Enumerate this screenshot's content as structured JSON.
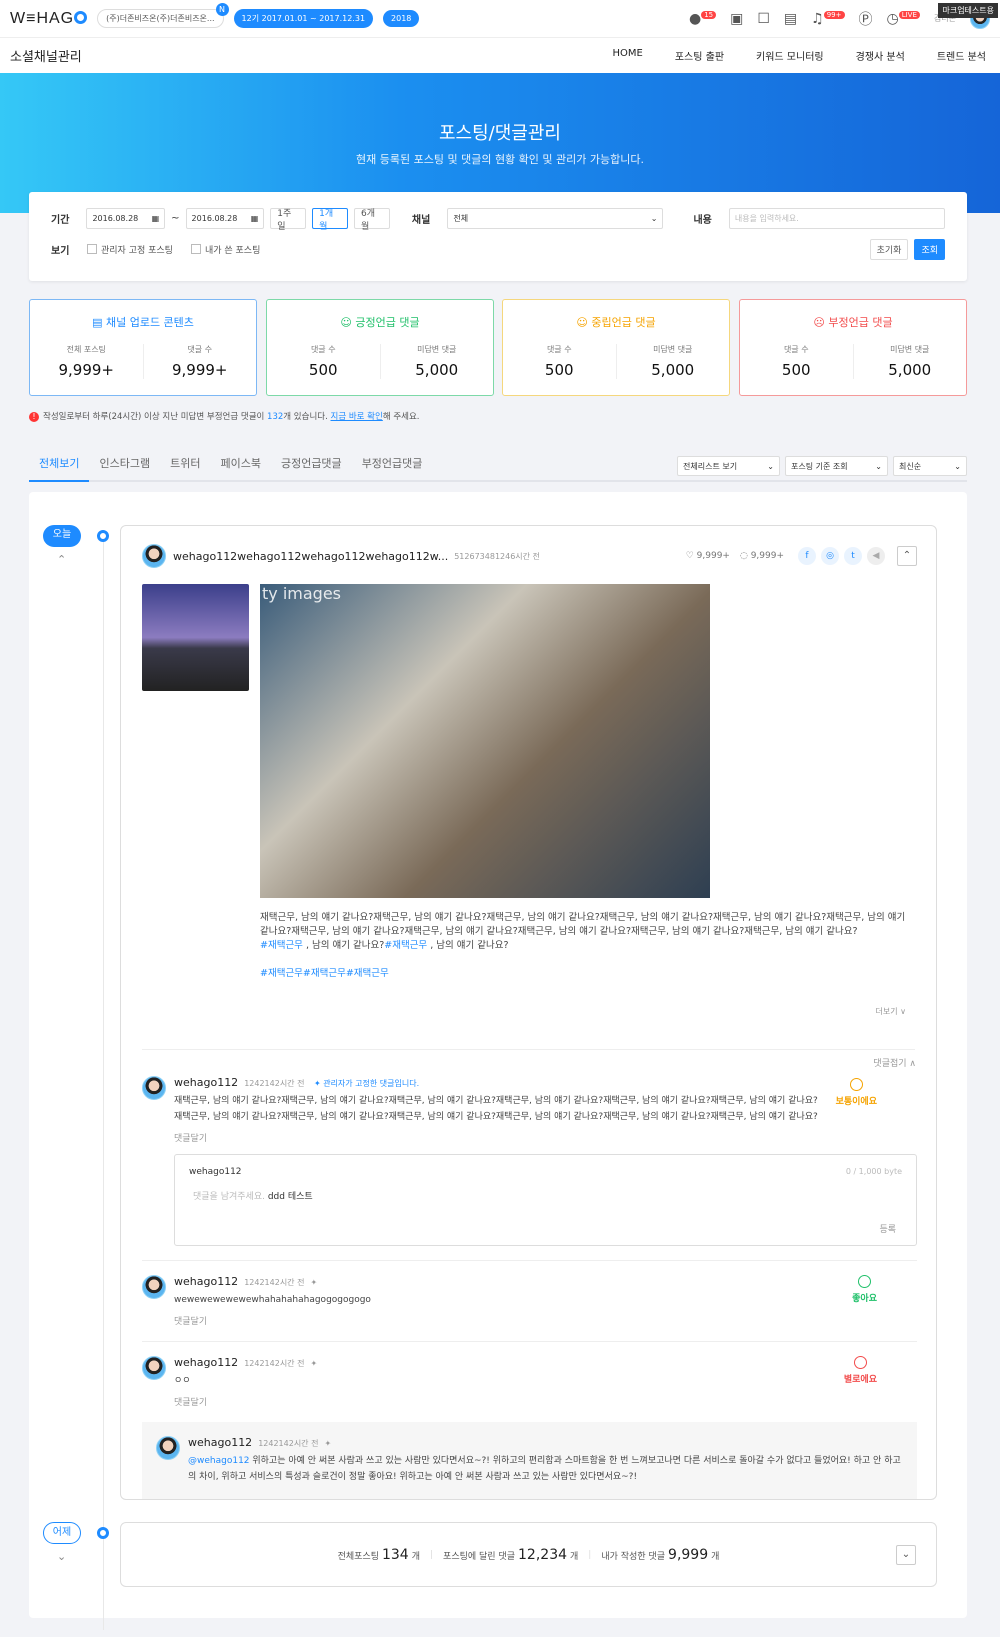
{
  "topbar": {
    "logo": "WEHAGO",
    "company": "(주)더존비즈온(주)더존비즈온...",
    "new_badge": "N",
    "period": "12기 2017.01.01 ~ 2017.12.31",
    "year": "2018",
    "profile_badge": "15",
    "bell_badge": "99+",
    "live_badge": "LIVE",
    "user_name": "김더존",
    "tag": "마크업테스트용"
  },
  "nav": {
    "title": "소셜채널관리",
    "menu": [
      "HOME",
      "포스팅 출판",
      "키워드 모니터링",
      "경쟁사 분석",
      "트렌드 분석"
    ]
  },
  "banner": {
    "title": "포스팅/댓글관리",
    "subtitle": "현재 등록된 포스팅 및 댓글의 현황 확인 및 관리가 가능합니다."
  },
  "filter": {
    "period_label": "기간",
    "date_from": "2016.08.28",
    "date_to": "2016.08.28",
    "range_buttons": [
      "1주일",
      "1개월",
      "6개월"
    ],
    "channel_label": "채널",
    "channel_value": "전체",
    "content_label": "내용",
    "content_placeholder": "내용을 입력하세요.",
    "view_label": "보기",
    "check1": "관리자 고정 포스팅",
    "check2": "내가 쓴 포스팅",
    "reset": "초기화",
    "search": "조회"
  },
  "stats": [
    {
      "title": "채널 업로드 콘텐츠",
      "l1": "전체 포스팅",
      "v1": "9,999+",
      "l2": "댓글 수",
      "v2": "9,999+",
      "color": "#1e8bff"
    },
    {
      "title": "긍정언급 댓글",
      "l1": "댓글 수",
      "v1": "500",
      "l2": "미답변 댓글",
      "v2": "5,000",
      "color": "#20c06a"
    },
    {
      "title": "중립언급 댓글",
      "l1": "댓글 수",
      "v1": "500",
      "l2": "미답변 댓글",
      "v2": "5,000",
      "color": "#f5a300"
    },
    {
      "title": "부정언급 댓글",
      "l1": "댓글 수",
      "v1": "500",
      "l2": "미답변 댓글",
      "v2": "5,000",
      "color": "#f24b4b"
    }
  ],
  "alert": {
    "pre": "작성일로부터 하루(24시간) 이상 지난 미답변 부정언급 댓글이 ",
    "count": "132",
    "mid": "개 있습니다. ",
    "link": "지금 바로 확인",
    "post": "해 주세요."
  },
  "tabs": [
    "전체보기",
    "인스타그램",
    "트위터",
    "페이스북",
    "긍정언급댓글",
    "부정언급댓글"
  ],
  "selects": [
    "전체리스트 보기",
    "포스팅 기준 조회",
    "최신순"
  ],
  "timeline": {
    "today": "오늘",
    "yesterday": "어제"
  },
  "post": {
    "user": "wehago112wehago112wehago112wehago112w...",
    "time": "512673481246시간 전",
    "likes": "9,999+",
    "comments": "9,999+",
    "watermark": "ty images",
    "body": "재택근무, 남의 얘기 같나요?재택근무, 남의 얘기 같나요?재택근무, 남의 얘기 같나요?재택근무, 남의 얘기 같나요?재택근무, 남의 얘기 같나요?재택근무, 남의 얘기 같나요?재택근무, 남의 얘기 같나요?재택근무, 남의 얘기 같나요?재택근무, 남의 얘기 같나요?재택근무, 남의 얘기 같나요?재택근무, 남의 얘기 같나요?",
    "hash1": "#재택근무",
    "t1": " , 남의 얘기 같나요?",
    "hash2": "#재택근무",
    "t2": " , 남의 얘기 같나요?",
    "hashes": "#재택근무#재택근무#재택근무",
    "more": "더보기 ∨",
    "fold": "댓글접기 ∧"
  },
  "comments": [
    {
      "user": "wehago112",
      "time": "1242142시간 전",
      "pinned": "관리자가 고정한 댓글입니다.",
      "text": "재택근무, 남의 얘기 같나요?재택근무, 남의 얘기 같나요?재택근무, 남의 얘기 같나요?재택근무, 남의 얘기 같나요?재택근무, 남의 얘기 같나요?재택근무, 남의 얘기 같나요?재택근무, 남의 얘기 같나요?재택근무, 남의 얘기 같나요?재택근무, 남의 얘기 같나요?재택근무, 남의 얘기 같나요?재택근무, 남의 얘기 같나요?재택근무, 남의 얘기 같나요?",
      "reply": "댓글달기",
      "sentiment": "보통이에요"
    },
    {
      "user": "wehago112",
      "time": "1242142시간 전",
      "text": "wewewewewewewhahahahahagogogogogo",
      "reply": "댓글달기",
      "sentiment": "좋아요"
    },
    {
      "user": "wehago112",
      "time": "1242142시간 전",
      "text": "ㅇㅇ",
      "reply": "댓글달기",
      "sentiment": "별로에요"
    }
  ],
  "reply_box": {
    "user": "wehago112",
    "bytes": "0 / 1,000 byte",
    "placeholder": "댓글을 남겨주세요.",
    "value": "ddd 테스트",
    "submit": "등록"
  },
  "nested": {
    "user": "wehago112",
    "time": "1242142시간 전",
    "mention": "@wehago112",
    "text": " 위하고는 아예 안 써본 사람과 쓰고 있는 사람만 있다면서요~?! 위하고의 편리함과 스마트함을 한 번 느껴보고나면 다른 서비스로 돌아갈 수가 없다고 들었어요! 하고 안 하고의 차이, 위하고 서비스의 특성과 슬로건이 정말 좋아요! 위하고는 아예 안 써본 사람과 쓰고 있는 사람만 있다면서요~?!"
  },
  "summary": {
    "l1": "전체포스팅",
    "v1": "134",
    "l2": "포스팅에 달린 댓글",
    "v2": "12,234",
    "l3": "내가 작성한 댓글",
    "v3": "9,999",
    "unit": "개"
  }
}
